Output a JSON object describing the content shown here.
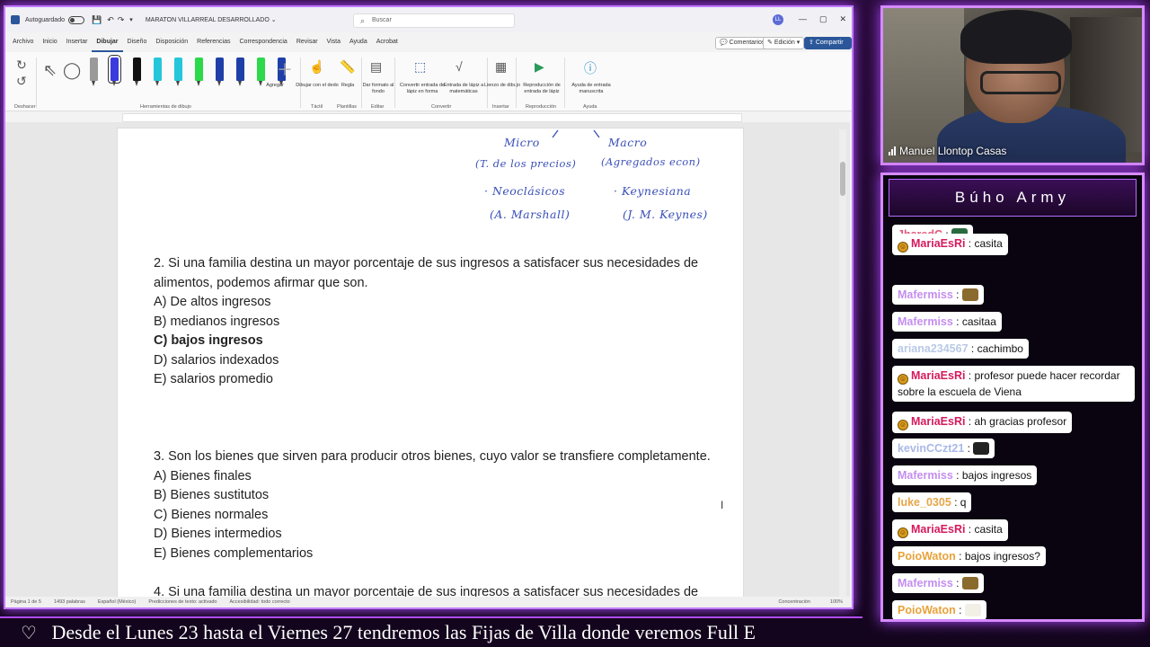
{
  "word": {
    "autosave_label": "Autoguardado",
    "doc_title": "MARATON VILLARREAL DESARROLLADO",
    "search_placeholder": "Buscar",
    "avatar_initials": "LL",
    "menu_tabs": [
      "Archivo",
      "Inicio",
      "Insertar",
      "Dibujar",
      "Diseño",
      "Disposición",
      "Referencias",
      "Correspondencia",
      "Revisar",
      "Vista",
      "Ayuda",
      "Acrobat"
    ],
    "active_tab": "Dibujar",
    "comments_label": "Comentarios",
    "edit_label": "Edición",
    "share_label": "Compartir",
    "ribbon": {
      "undo_label": "Deshacer",
      "drawing_tools_label": "Herramientas de dibujo",
      "add_label": "Agregar",
      "draw_finger_label": "Dibujar con el dedo",
      "touch_group": "Táctil",
      "ruler_label": "Regla",
      "stencils_group": "Plantillas",
      "format_bg_label": "Dar formato al fondo",
      "edit_group": "Editar",
      "ink_shape_label": "Convertir entrada de lápiz en forma",
      "ink_math_label": "Entrada de lápiz a matemáticas",
      "convert_group": "Convertir",
      "canvas_label": "Lienzo de dibujo",
      "insert_group": "Insertar",
      "replay_label": "Reproducción de entrada de lápiz",
      "replay_group": "Reproducción",
      "help_ink_label": "Ayuda de entrada manuscrita",
      "help_group": "Ayuda",
      "pen_colors": [
        "#111111",
        "#26c6da",
        "#26c6da",
        "#2bd94a",
        "#1f3fa8",
        "#1f3fa8",
        "#2bd94a",
        "#1f3fa8"
      ]
    },
    "status": {
      "page": "Página 1 de 5",
      "words": "1493 palabras",
      "lang": "Español (México)",
      "predict": "Predicciones de texto: activado",
      "access": "Accesibilidad: todo correcto",
      "focus": "Concentración",
      "zoom": "100%"
    }
  },
  "handwriting": {
    "micro": "Micro",
    "micro_sub": "(T. de los precios)",
    "neo": "· Neoclásicos",
    "marshall": "(A. Marshall)",
    "macro": "Macro",
    "macro_sub": "(Agregados econ)",
    "keynes": "· Keynesiana",
    "keynes_name": "(J. M. Keynes)"
  },
  "doc": {
    "q2_line1": "2. Si una familia destina un mayor porcentaje de sus ingresos a satisfacer sus necesidades de",
    "q2_line2": "alimentos, podemos afirmar que son.",
    "q2_opts": [
      "A) De altos ingresos",
      "B) medianos ingresos",
      "C) bajos ingresos",
      "D) salarios indexados",
      "E) salarios promedio"
    ],
    "q3_line1": "3. Son los bienes que sirven para producir otros bienes, cuyo valor se transfiere completamente.",
    "q3_opts": [
      "A) Bienes finales",
      "B) Bienes sustitutos",
      "C) Bienes normales",
      "D) Bienes intermedios",
      "E) Bienes complementarios"
    ],
    "q4_line1": "4. Si una familia destina un mayor porcentaje de sus ingresos a satisfacer sus necesidades de"
  },
  "webcam": {
    "name": "Manuel Llontop Casas"
  },
  "chat": {
    "title": "Búho Army",
    "messages": [
      {
        "user": "JharedC",
        "color": "#e0567a",
        "text": "",
        "badge": false,
        "emote": "#2a6a3f"
      },
      {
        "user": "MariaEsRi",
        "color": "#d61a5c",
        "text": "casita",
        "badge": true,
        "emote": ""
      },
      {
        "user": "Mafermiss",
        "color": "#c48ef0",
        "text": "",
        "badge": false,
        "emote": "#8b6a2e"
      },
      {
        "user": "Mafermiss",
        "color": "#c48ef0",
        "text": "casitaa",
        "badge": false,
        "emote": ""
      },
      {
        "user": "ariana234567",
        "color": "#b9c9e6",
        "text": "cachimbo",
        "badge": false,
        "emote": ""
      },
      {
        "user": "MariaEsRi",
        "color": "#d61a5c",
        "text": "profesor puede hacer recordar sobre la escuela de Viena",
        "badge": true,
        "emote": ""
      },
      {
        "user": "MariaEsRi",
        "color": "#d61a5c",
        "text": "ah gracias profesor",
        "badge": true,
        "emote": ""
      },
      {
        "user": "kevinCCzt21",
        "color": "#a9b8e8",
        "text": "",
        "badge": false,
        "emote": "#222222"
      },
      {
        "user": "Mafermiss",
        "color": "#c48ef0",
        "text": "bajos ingresos",
        "badge": false,
        "emote": ""
      },
      {
        "user": "luke_0305",
        "color": "#e6a64a",
        "text": "q",
        "badge": false,
        "emote": ""
      },
      {
        "user": "MariaEsRi",
        "color": "#d61a5c",
        "text": "casita",
        "badge": true,
        "emote": ""
      },
      {
        "user": "PoioWaton",
        "color": "#e8a23a",
        "text": "bajos ingresos?",
        "badge": false,
        "emote": ""
      },
      {
        "user": "Mafermiss",
        "color": "#c48ef0",
        "text": "",
        "badge": false,
        "emote": "#8b6a2e"
      },
      {
        "user": "PoioWaton",
        "color": "#e8a23a",
        "text": "",
        "badge": false,
        "emote": "#f2efe6"
      }
    ]
  },
  "ticker": {
    "heart": "♡",
    "text": "Desde el Lunes 23 hasta el Viernes 27 tendremos las Fijas de Villa donde veremos Full E"
  }
}
